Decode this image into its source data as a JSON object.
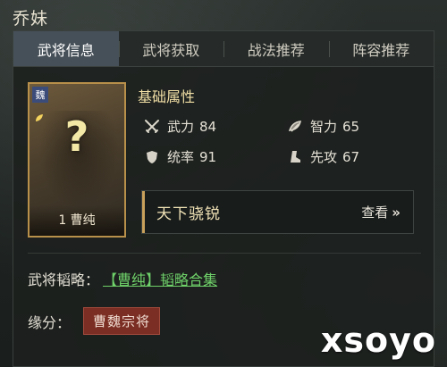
{
  "header": {
    "title": "乔妹"
  },
  "tabs": [
    {
      "label": "武将信息",
      "active": true
    },
    {
      "label": "武将获取",
      "active": false
    },
    {
      "label": "战法推荐",
      "active": false
    },
    {
      "label": "阵容推荐",
      "active": false
    }
  ],
  "card": {
    "faction": "魏",
    "placeholder": "?",
    "name": "1 曹纯"
  },
  "attributes": {
    "title": "基础属性",
    "items": [
      {
        "label": "武力",
        "value": "84",
        "icon": "sword-icon"
      },
      {
        "label": "智力",
        "value": "65",
        "icon": "book-icon"
      },
      {
        "label": "统率",
        "value": "91",
        "icon": "shield-icon"
      },
      {
        "label": "先攻",
        "value": "67",
        "icon": "boot-icon"
      }
    ]
  },
  "skill": {
    "name": "天下骁锐",
    "view_label": "查看",
    "arrow": "»"
  },
  "tactics": {
    "label": "武将韬略：",
    "link": "【曹纯】韬略合集"
  },
  "fate": {
    "label": "缘分：",
    "badge": "曹魏宗将"
  },
  "watermark": {
    "text": "xsoyo"
  },
  "colors": {
    "accent_gold": "#c9a15b",
    "tab_active": "#465058",
    "link_green": "#6fd16a",
    "fate_red": "#7a2e24"
  }
}
